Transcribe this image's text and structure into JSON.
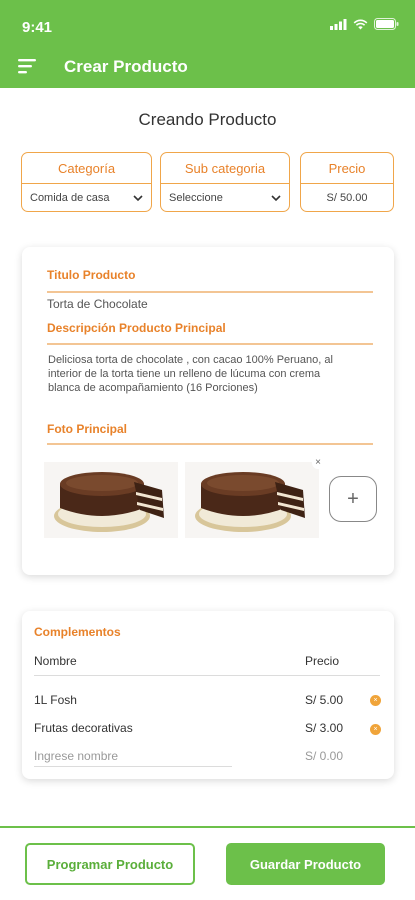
{
  "status_bar": {
    "time": "9:41"
  },
  "app_bar": {
    "title": "Crear Producto"
  },
  "page": {
    "title": "Creando Producto"
  },
  "fields": {
    "category": {
      "label": "Categoría",
      "value": "Comida de casa"
    },
    "subcategory": {
      "label": "Sub categoria",
      "value": "Seleccione"
    },
    "price": {
      "label": "Precio",
      "value": "S/ 50.00"
    }
  },
  "product": {
    "title_label": "Titulo Producto",
    "title_value": "Torta de Chocolate",
    "description_label": "Descripción Producto  Principal",
    "description_value": "Deliciosa torta de chocolate , con cacao 100% Peruano, al interior de la torta tiene un relleno de lúcuma con crema blanca de acompañamiento (16 Porciones)",
    "photo_label": "Foto Principal",
    "add_photo_symbol": "+",
    "remove_symbol": "×"
  },
  "complements": {
    "title": "Complementos",
    "col_name": "Nombre",
    "col_price": "Precio",
    "rows": [
      {
        "name": "1L Fosh",
        "price": "S/ 5.00"
      },
      {
        "name": "Frutas decorativas",
        "price": "S/ 3.00"
      }
    ],
    "new_row": {
      "name_placeholder": "Ingrese nombre",
      "price_placeholder": "S/ 0.00"
    },
    "remove_symbol": "×"
  },
  "actions": {
    "schedule_label": "Programar Producto",
    "save_label": "Guardar Producto"
  },
  "colors": {
    "brand_green": "#6cc04a",
    "accent_orange": "#e8822a",
    "remove_dot_orange": "#f0a43a"
  }
}
